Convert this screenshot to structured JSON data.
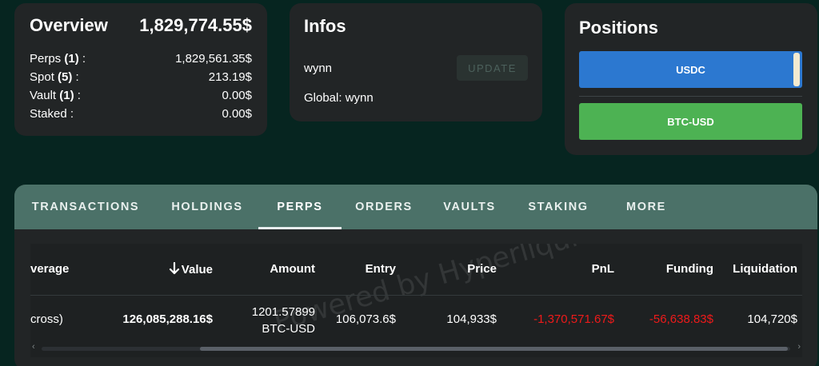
{
  "overview": {
    "title": "Overview",
    "total": "1,829,774.55$",
    "rows": [
      {
        "label": "Perps",
        "count": "(1)",
        "suffix": " :",
        "value": "1,829,561.35$"
      },
      {
        "label": "Spot",
        "count": "(5)",
        "suffix": " :",
        "value": "213.19$"
      },
      {
        "label": "Vault",
        "count": "(1)",
        "suffix": " :",
        "value": "0.00$"
      },
      {
        "label": "Staked :",
        "count": "",
        "suffix": "",
        "value": "0.00$"
      }
    ]
  },
  "infos": {
    "title": "Infos",
    "user": "wynn",
    "global": "Global: wynn",
    "update_label": "UPDATE"
  },
  "positions": {
    "title": "Positions",
    "items": [
      {
        "label": "USDC",
        "color": "#2c78d0"
      },
      {
        "label": "BTC-USD",
        "color": "#4db253"
      }
    ]
  },
  "tabs": [
    "TRANSACTIONS",
    "HOLDINGS",
    "PERPS",
    "ORDERS",
    "VAULTS",
    "STAKING",
    "MORE"
  ],
  "active_tab": "PERPS",
  "table": {
    "headers": {
      "leverage": "verage",
      "value": "Value",
      "amount": "Amount",
      "entry": "Entry",
      "price": "Price",
      "pnl": "PnL",
      "funding": "Funding",
      "liquidation": "Liquidation"
    },
    "row": {
      "leverage": "cross)",
      "value": "126,085,288.16$",
      "amount_qty": "1201.57899",
      "amount_asset": "BTC-USD",
      "entry": "106,073.6$",
      "price": "104,933$",
      "pnl": "-1,370,571.67$",
      "funding": "-56,638.83$",
      "liquidation": "104,720$"
    },
    "watermark": "Powered by Hyperliquid",
    "sort_icon": "arrow-down-icon"
  },
  "colors": {
    "background": "#062520",
    "card": "#222526",
    "tabbar": "#4b7168",
    "negative": "#ef1a1a"
  }
}
